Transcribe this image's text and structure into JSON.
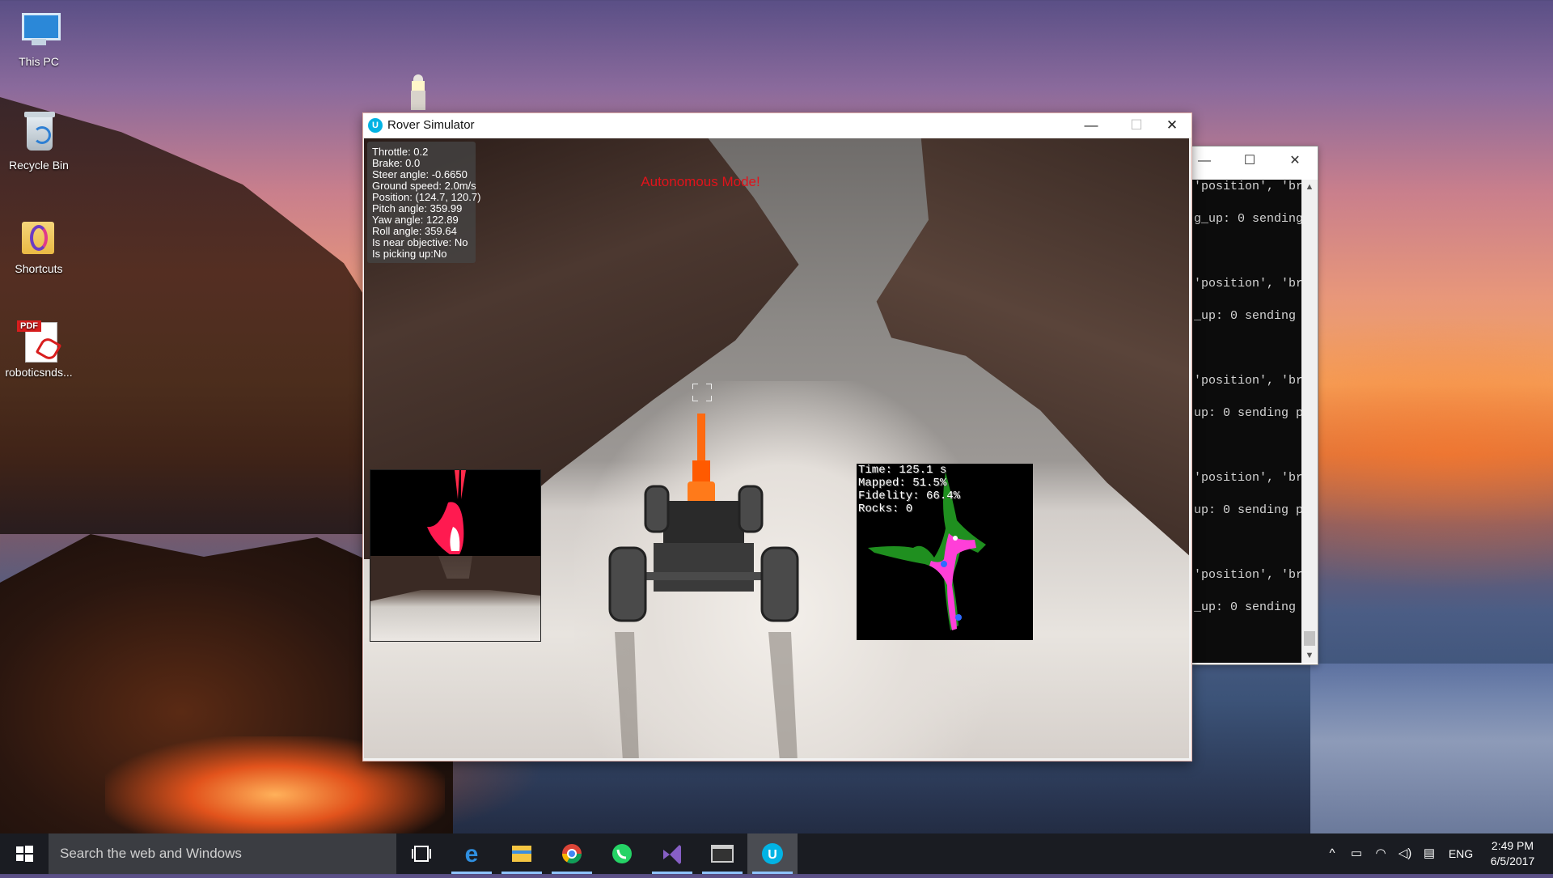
{
  "desktop": {
    "icons": [
      {
        "label": "This PC",
        "icon": "pc-icon"
      },
      {
        "label": "Recycle Bin",
        "icon": "recycle-bin-icon"
      },
      {
        "label": "Shortcuts",
        "icon": "folder-icon"
      },
      {
        "label": "roboticsnds...",
        "icon": "pdf-icon",
        "badge": "PDF"
      }
    ]
  },
  "console": {
    "lines": [
      "'position', 'br",
      "g_up: 0 sending",
      "'position', 'br",
      "_up: 0 sending",
      "'position', 'br",
      "up: 0 sending p",
      "'position', 'br",
      "up: 0 sending p",
      "'position', 'br",
      "_up: 0 sending"
    ]
  },
  "rover_window": {
    "title": "Rover Simulator",
    "app_icon_letter": "U",
    "mode_text": "Autonomous Mode!",
    "stats": [
      "Throttle: 0.2",
      "Brake: 0.0",
      "Steer angle: -0.6650",
      "Ground speed: 2.0m/s",
      "Position: (124.7, 120.7)",
      "Pitch angle: 359.99",
      "Yaw angle: 122.89",
      "Roll angle: 359.64",
      "Is near objective: No",
      "Is picking up:No"
    ],
    "map_stats": [
      "Time: 125.1 s",
      "Mapped: 51.5%",
      "Fidelity: 66.4%",
      "Rocks: 0"
    ]
  },
  "taskbar": {
    "search_placeholder": "Search the web and Windows",
    "language": "ENG",
    "time": "2:49 PM",
    "date": "6/5/2017",
    "apps": [
      "task-view-icon",
      "edge-icon",
      "file-explorer-icon",
      "chrome-icon",
      "whatsapp-icon",
      "visual-studio-icon",
      "terminal-icon",
      "udacity-icon"
    ]
  },
  "colors": {
    "mode_text": "#e1131b",
    "taskbar": "#1a1c22",
    "accent": "#02b3e4"
  }
}
